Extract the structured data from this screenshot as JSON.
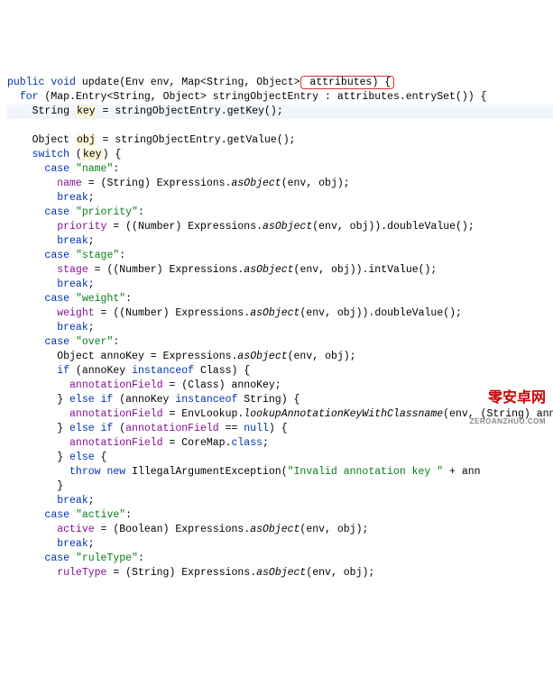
{
  "k": {
    "public": "public",
    "void": "void",
    "for": "for",
    "switch": "switch",
    "case": "case",
    "break": "break",
    "if": "if",
    "elseif": "else if",
    "else": "else",
    "instanceof": "instanceof",
    "new": "new",
    "null": "null",
    "class": "class"
  },
  "t": {
    "Env": "Env",
    "Map": "Map",
    "String": "String",
    "Object": "Object",
    "Entry": "Map.Entry<String, Object>",
    "Class": "Class",
    "Number": "Number",
    "Boolean": "Boolean"
  },
  "m": {
    "update": "update",
    "entrySet": "entrySet",
    "getKey": "getKey",
    "getValue": "getValue",
    "asObject": "asObject",
    "doubleValue": "doubleValue",
    "intValue": "intValue",
    "lookup": "lookupAnnotationKeyWithClassname"
  },
  "v": {
    "env": "env",
    "attributes": "attributes",
    "soe": "stringObjectEntry",
    "key": "key",
    "obj": "obj",
    "annoKey": "annoKey"
  },
  "f": {
    "name": "name",
    "priority": "priority",
    "stage": "stage",
    "weight": "weight",
    "annotationField": "annotationField",
    "active": "active",
    "ruleType": "ruleType"
  },
  "cls": {
    "Expressions": "Expressions",
    "EnvLookup": "EnvLookup",
    "CoreMap": "CoreMap",
    "IAE": "IllegalArgumentException"
  },
  "s": {
    "name": "\"name\"",
    "priority": "\"priority\"",
    "stage": "\"stage\"",
    "weight": "\"weight\"",
    "over": "\"over\"",
    "active": "\"active\"",
    "ruleType": "\"ruleType\"",
    "err": "\"Invalid annotation key \""
  },
  "wm": {
    "main": "零安卓网",
    "sub": "ZEROANZHUO.COM"
  }
}
